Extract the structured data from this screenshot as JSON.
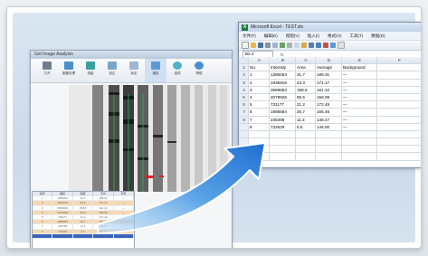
{
  "app": {
    "title": "Gel Image Analysis",
    "toolbar": [
      "打开",
      "图像处理",
      "测量",
      "校正",
      "标定",
      "报告",
      "选项",
      "帮助"
    ]
  },
  "mini_table": {
    "headers": [
      "编号",
      "面积",
      "强度",
      "平均",
      "背景"
    ],
    "rows": [
      [
        "1",
        "1359253",
        "31.7",
        "189.31",
        "—"
      ],
      [
        "2",
        "1935918",
        "43.3",
        "171.17",
        "—"
      ],
      [
        "3",
        "3569663",
        "158.8",
        "161.10",
        "—"
      ],
      [
        "4",
        "2079928",
        "95.5",
        "158.08",
        "—"
      ],
      [
        "5",
        "731177",
        "21.2",
        "172.49",
        "—"
      ],
      [
        "6",
        "1986584",
        "26.7",
        "166.46",
        "—"
      ],
      [
        "7",
        "235498",
        "11.3",
        "148.47",
        "—"
      ],
      [
        "8",
        "732629",
        "5.5",
        "145.00",
        "—"
      ]
    ]
  },
  "excel": {
    "title": "Microsoft Excel - TEST.xls",
    "menu": [
      "文件(F)",
      "编辑(E)",
      "视图(V)",
      "插入(I)",
      "格式(O)",
      "工具(T)",
      "数据(D)"
    ],
    "name_box": "B2.4",
    "fx": "fx",
    "columns": [
      "",
      "A",
      "B",
      "C",
      "D",
      "E",
      "F"
    ],
    "header_row": [
      "1",
      "No.",
      "Intensity",
      "Area",
      "Average",
      "Background",
      ""
    ],
    "rows": [
      [
        "2",
        "1",
        "1359253",
        "31.7",
        "189.31",
        "—",
        ""
      ],
      [
        "3",
        "2",
        "1935918",
        "43.3",
        "171.17",
        "—",
        ""
      ],
      [
        "4",
        "3",
        "3569663",
        "158.8",
        "161.10",
        "—",
        ""
      ],
      [
        "5",
        "4",
        "2079928",
        "95.5",
        "158.08",
        "—",
        ""
      ],
      [
        "6",
        "5",
        "731177",
        "21.2",
        "172.49",
        "—",
        ""
      ],
      [
        "7",
        "6",
        "1986584",
        "26.7",
        "166.46",
        "—",
        ""
      ],
      [
        "8",
        "7",
        "235498",
        "11.3",
        "148.47",
        "—",
        ""
      ],
      [
        "",
        "8",
        "732629",
        "5.5",
        "145.00",
        "—",
        ""
      ]
    ]
  }
}
